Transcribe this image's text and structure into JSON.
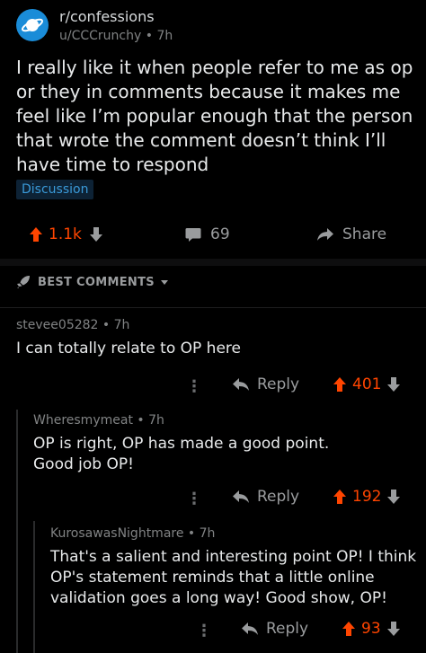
{
  "post": {
    "subreddit": "r/confessions",
    "author": "u/CCCrunchy",
    "time": "7h",
    "title": "I really like it when people refer to me as op or they in comments because it makes me feel like I’m popular enough that the person that wrote the comment doesn’t think I’ll have time to respond",
    "flair": "Discussion",
    "upvotes": "1.1k",
    "comments": "69",
    "share_label": "Share"
  },
  "sort": {
    "label": "BEST COMMENTS"
  },
  "comments": [
    {
      "author": "stevee05282",
      "time": "7h",
      "body": "I can totally relate to OP here",
      "reply_label": "Reply",
      "score": "401"
    },
    {
      "author": "Wheresmymeat",
      "time": "7h",
      "body_lines": [
        "OP is right, OP has made a good point.",
        "Good job OP!"
      ],
      "reply_label": "Reply",
      "score": "192"
    },
    {
      "author": "KurosawasNightmare",
      "time": "7h",
      "body_lines": [
        "That's a salient and interesting point OP! I think",
        "OP's statement reminds that a little online",
        "validation goes a long way! Good show, OP!"
      ],
      "reply_label": "Reply",
      "score": "93"
    }
  ],
  "colors": {
    "accent": "#ff4500",
    "link": "#3a9ad9",
    "background": "#000000"
  }
}
